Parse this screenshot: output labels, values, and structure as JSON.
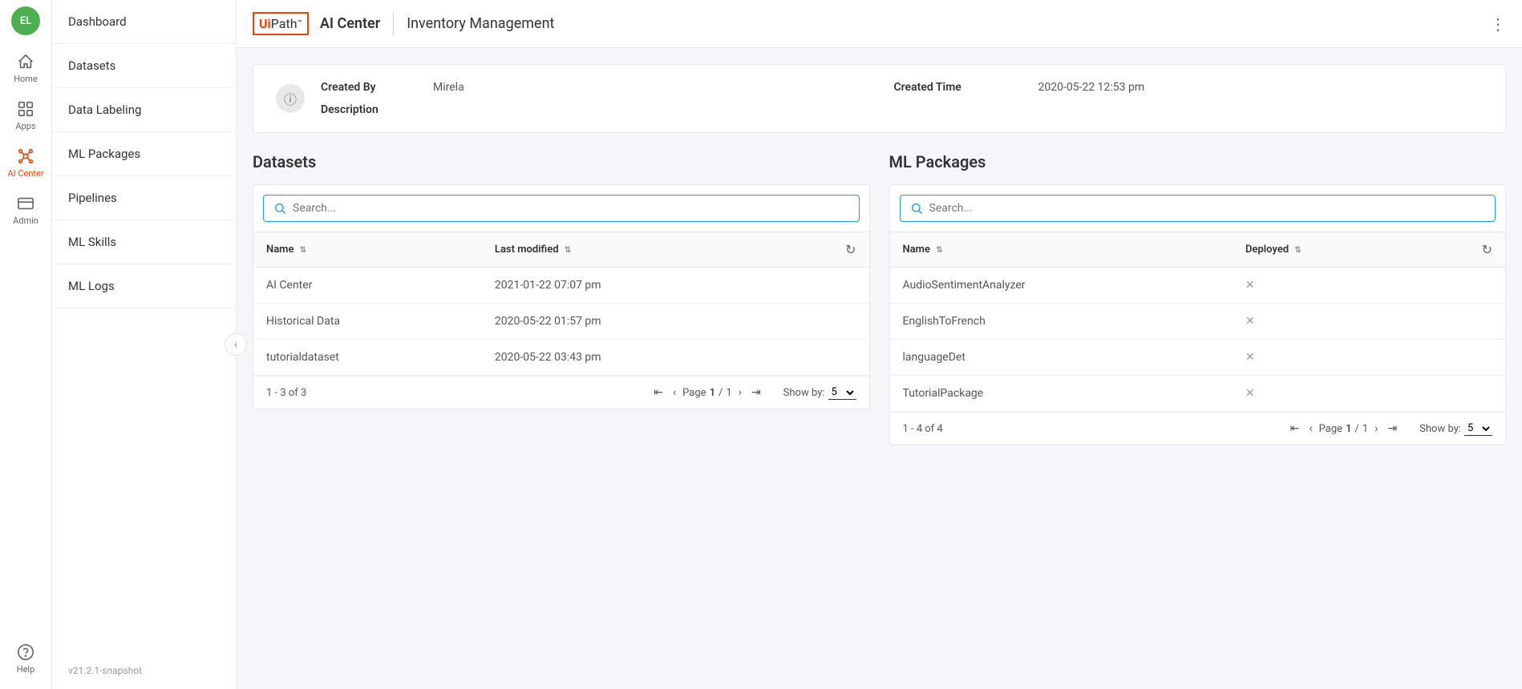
{
  "header": {
    "logo_ui": "Ui",
    "logo_path": "Path",
    "logo_tm": "™",
    "logo_center": "AI Center",
    "page_title": "Inventory Management",
    "three_dots": "⋮"
  },
  "icon_sidebar": {
    "avatar_initials": "EL",
    "nav_items": [
      {
        "id": "home",
        "label": "Home",
        "active": false
      },
      {
        "id": "apps",
        "label": "Apps",
        "active": false
      },
      {
        "id": "ai-center",
        "label": "AI Center",
        "active": true
      },
      {
        "id": "admin",
        "label": "Admin",
        "active": false
      }
    ],
    "help_label": "Help"
  },
  "nav_sidebar": {
    "items": [
      {
        "id": "dashboard",
        "label": "Dashboard"
      },
      {
        "id": "datasets",
        "label": "Datasets"
      },
      {
        "id": "data-labeling",
        "label": "Data Labeling"
      },
      {
        "id": "ml-packages",
        "label": "ML Packages"
      },
      {
        "id": "pipelines",
        "label": "Pipelines"
      },
      {
        "id": "ml-skills",
        "label": "ML Skills"
      },
      {
        "id": "ml-logs",
        "label": "ML Logs"
      }
    ],
    "version": "v21.2.1-snapshot"
  },
  "info_card": {
    "created_by_label": "Created By",
    "created_by_value": "Mirela",
    "description_label": "Description",
    "description_value": "",
    "created_time_label": "Created Time",
    "created_time_value": "2020-05-22 12:53 pm"
  },
  "datasets_panel": {
    "title": "Datasets",
    "search_placeholder": "Search...",
    "columns": {
      "name": "Name",
      "last_modified": "Last modified"
    },
    "rows": [
      {
        "name": "AI Center",
        "last_modified": "2021-01-22 07:07 pm"
      },
      {
        "name": "Historical Data",
        "last_modified": "2020-05-22 01:57 pm"
      },
      {
        "name": "tutorialdataset",
        "last_modified": "2020-05-22 03:43 pm"
      }
    ],
    "pagination": {
      "range": "1 - 3 of 3",
      "page_current": "1",
      "page_total": "1",
      "show_by_label": "Show by:",
      "show_by_value": "5"
    }
  },
  "ml_packages_panel": {
    "title": "ML Packages",
    "search_placeholder": "Search...",
    "columns": {
      "name": "Name",
      "deployed": "Deployed"
    },
    "rows": [
      {
        "name": "AudioSentimentAnalyzer",
        "deployed": false
      },
      {
        "name": "EnglishToFrench",
        "deployed": false
      },
      {
        "name": "languageDet",
        "deployed": false
      },
      {
        "name": "TutorialPackage",
        "deployed": false
      }
    ],
    "pagination": {
      "range": "1 - 4 of 4",
      "page_current": "1",
      "page_total": "1",
      "show_by_label": "Show by:",
      "show_by_value": "5"
    }
  }
}
